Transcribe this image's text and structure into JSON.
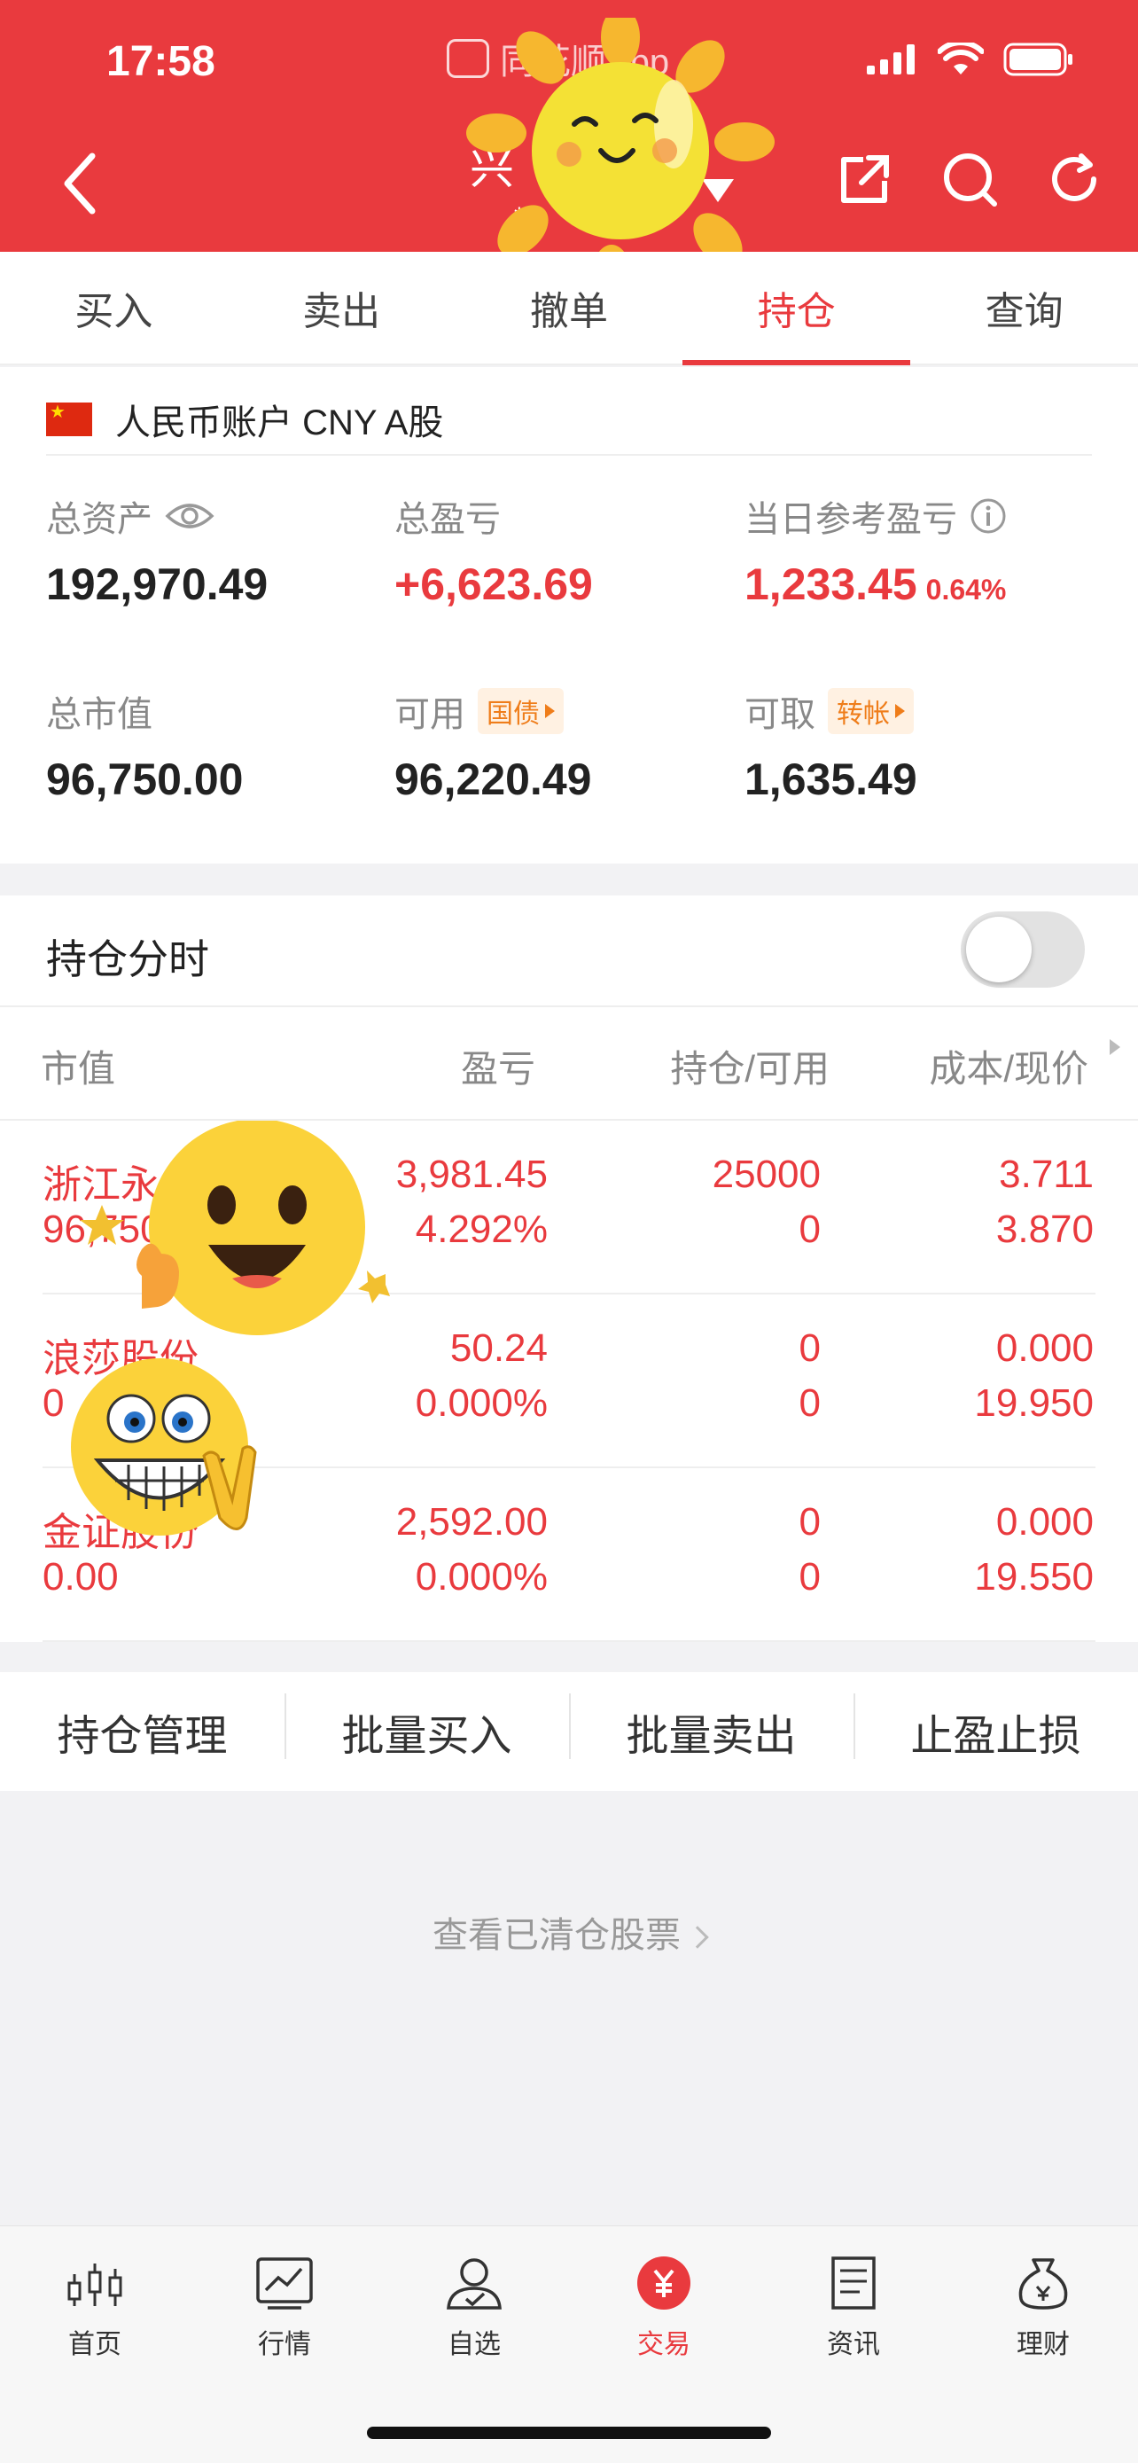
{
  "status_bar": {
    "time": "17:58",
    "app_name": "同花顺App"
  },
  "nav": {
    "title": "兴",
    "subtitle": "**",
    "icons": [
      "back-icon",
      "share-icon",
      "search-icon",
      "refresh-icon"
    ]
  },
  "tabs": [
    {
      "label": "买入",
      "active": false
    },
    {
      "label": "卖出",
      "active": false
    },
    {
      "label": "撤单",
      "active": false
    },
    {
      "label": "持仓",
      "active": true
    },
    {
      "label": "查询",
      "active": false
    }
  ],
  "account": {
    "label": "人民币账户 CNY A股"
  },
  "metrics": {
    "total_assets": {
      "label": "总资产",
      "value": "192,970.49"
    },
    "total_pl": {
      "label": "总盈亏",
      "value": "+6,623.69"
    },
    "daily_pl": {
      "label": "当日参考盈亏",
      "value": "1,233.45",
      "pct": "0.64%"
    },
    "market_value": {
      "label": "总市值",
      "value": "96,750.00"
    },
    "available": {
      "label": "可用",
      "tag": "国债",
      "value": "96,220.49"
    },
    "withdrawable": {
      "label": "可取",
      "tag": "转帐",
      "value": "1,635.49"
    }
  },
  "timeshare": {
    "label": "持仓分时",
    "enabled": false
  },
  "columns": {
    "c1": "市值",
    "c2": "盈亏",
    "c3": "持仓/可用",
    "c4": "成本/现价"
  },
  "holdings": [
    {
      "name": "浙江永",
      "value": "96,750",
      "pl": "3,981.45",
      "pl_pct": "4.292%",
      "qty": "25000",
      "avail": "0",
      "cost": "3.711",
      "price": "3.870"
    },
    {
      "name": "浪莎股份",
      "value": "0",
      "pl": "50.24",
      "pl_pct": "0.000%",
      "qty": "0",
      "avail": "0",
      "cost": "0.000",
      "price": "19.950"
    },
    {
      "name": "金证股份",
      "value": "0.00",
      "pl": "2,592.00",
      "pl_pct": "0.000%",
      "qty": "0",
      "avail": "0",
      "cost": "0.000",
      "price": "19.550"
    }
  ],
  "actions": [
    "持仓管理",
    "批量买入",
    "批量卖出",
    "止盈止损"
  ],
  "cleared_link": "查看已清仓股票",
  "tabbar": [
    {
      "label": "首页",
      "icon": "candlestick-icon"
    },
    {
      "label": "行情",
      "icon": "chart-icon"
    },
    {
      "label": "自选",
      "icon": "user-check-icon"
    },
    {
      "label": "交易",
      "icon": "yuan-icon",
      "active": true
    },
    {
      "label": "资讯",
      "icon": "news-icon"
    },
    {
      "label": "理财",
      "icon": "money-bag-icon"
    }
  ],
  "colors": {
    "brand_red": "#e93a3e",
    "tag_orange": "#ef7d1a"
  }
}
